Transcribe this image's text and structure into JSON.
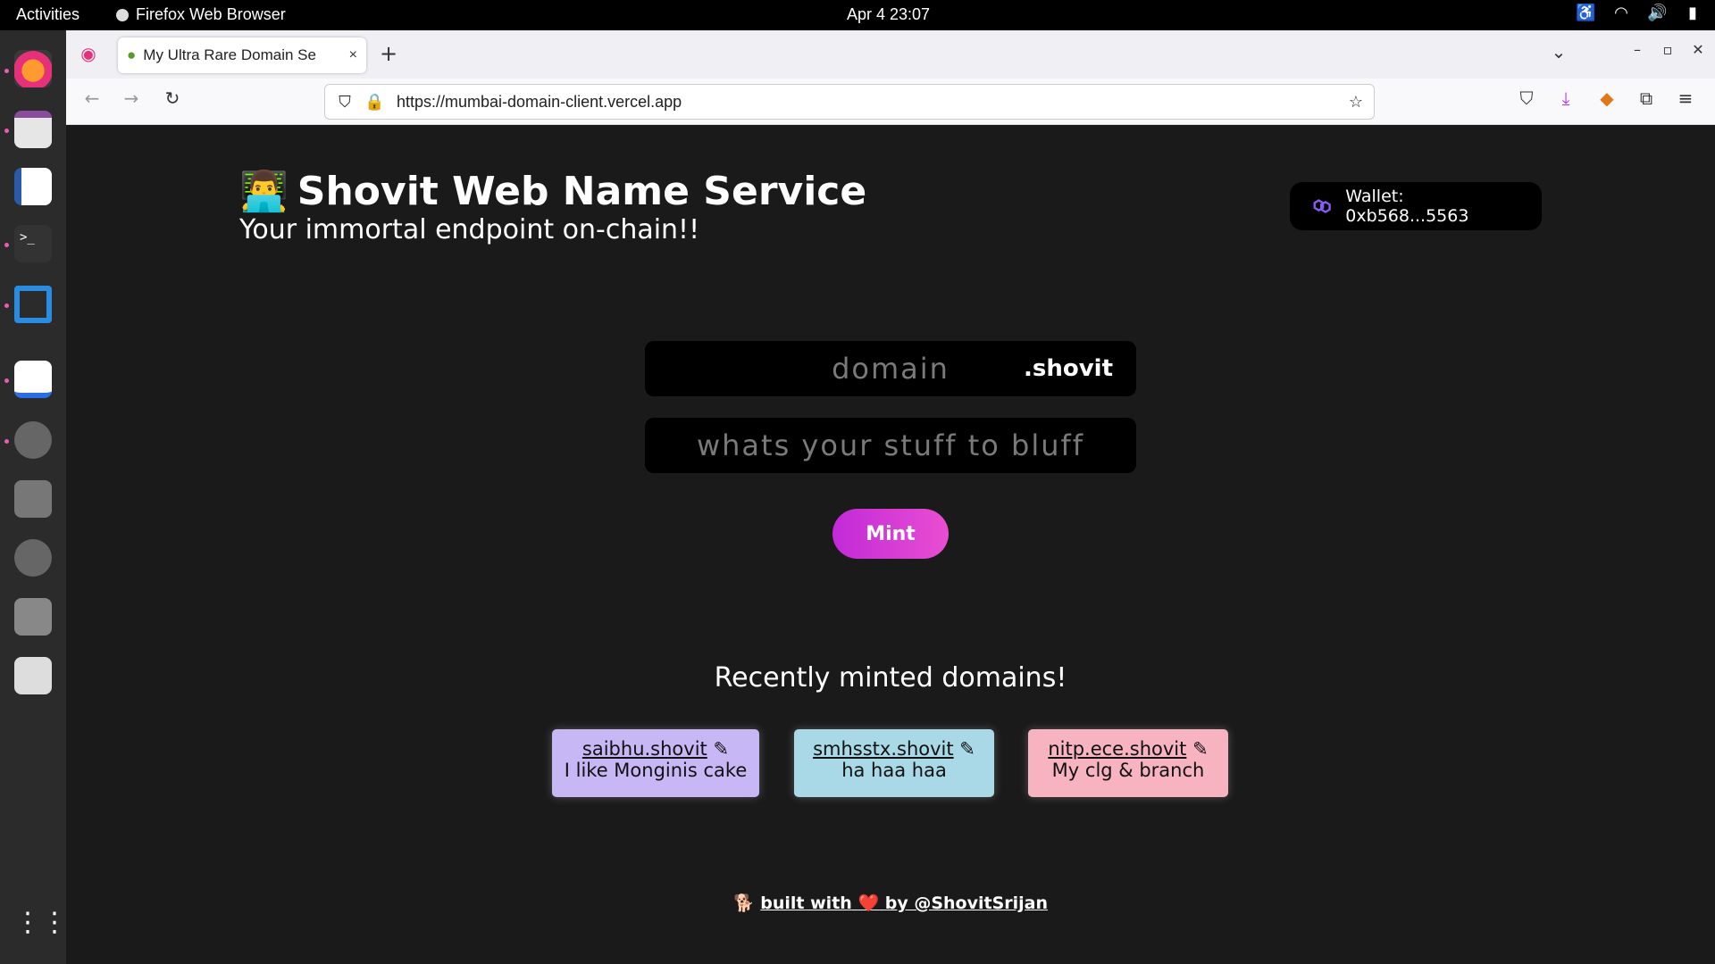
{
  "topbar": {
    "activities": "Activities",
    "app_name": "Firefox Web Browser",
    "clock": "Apr 4  23:07"
  },
  "browser": {
    "tab_title": "My Ultra Rare Domain Se",
    "tab_close": "×",
    "new_tab": "+",
    "url": "https://mumbai-domain-client.vercel.app"
  },
  "page": {
    "title": "Shovit Web Name Service",
    "title_emoji": "👨‍💻",
    "subtitle": "Your immortal endpoint on-chain!!",
    "wallet_label": "Wallet: 0xb568...5563",
    "domain_placeholder": "domain",
    "tld": ".shovit",
    "record_placeholder": "whats your stuff to bluff",
    "mint_label": "Mint",
    "recent_title": "Recently minted domains!",
    "domains": [
      {
        "name": "saibhu.shovit",
        "record": "I like Monginis cake",
        "color": "#c7b8f5"
      },
      {
        "name": "smhsstx.shovit",
        "record": "ha haa haa",
        "color": "#a9d8e6"
      },
      {
        "name": "nitp.ece.shovit",
        "record": "My clg & branch",
        "color": "#f7b3c0"
      }
    ],
    "footer_prefix": "built with",
    "footer_suffix": "by @ShovitSrijan",
    "footer_heart": "❤️"
  },
  "colors": {
    "accent": "#d63adb",
    "page_bg": "#1a1a1a"
  }
}
